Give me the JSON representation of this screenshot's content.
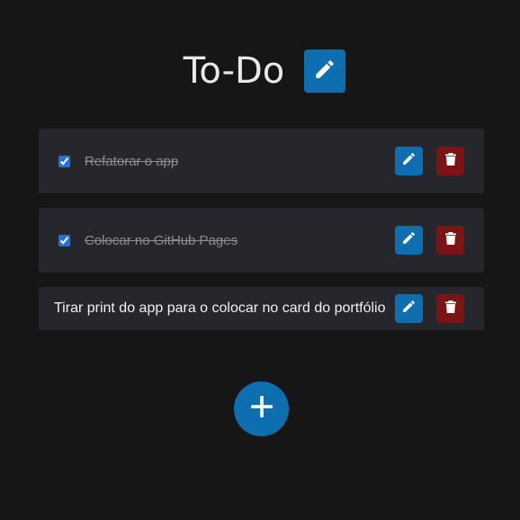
{
  "app": {
    "title": "To-Do"
  },
  "colors": {
    "background": "#161617",
    "card": "#26272c",
    "primary": "#0d6eb0",
    "danger": "#7c1416",
    "title_text": "#e9e9ea",
    "done_text": "#8d8e92",
    "pending_text": "#f1f1f1"
  },
  "icons": {
    "title_edit": "pencil-icon",
    "item_edit": "pencil-icon",
    "item_delete": "trash-icon",
    "add": "plus-icon"
  },
  "todos": [
    {
      "text": "Refatorar o app",
      "done": true
    },
    {
      "text": "Colocar no GitHub Pages",
      "done": true
    },
    {
      "text": "Tirar print do app para o colocar no card do portfólio",
      "done": false
    }
  ]
}
